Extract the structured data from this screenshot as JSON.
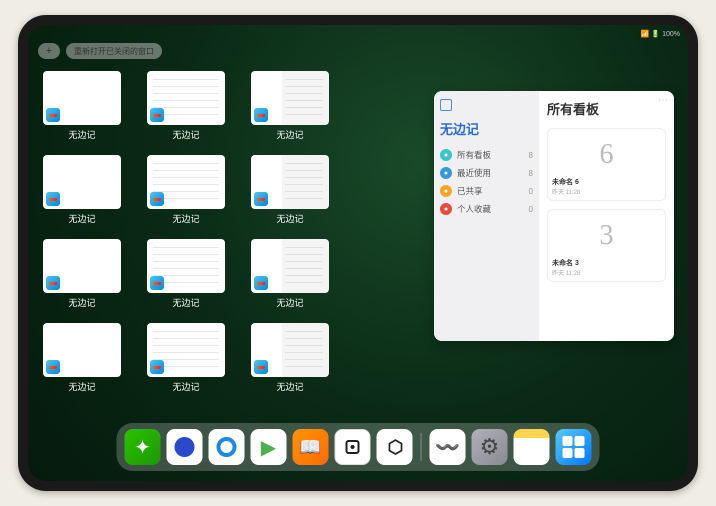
{
  "statusbar": {
    "wifi_text": "100%"
  },
  "topbar": {
    "plus_label": "+",
    "reopen_label": "重新打开已关闭的窗口"
  },
  "windows": [
    {
      "label": "无边记",
      "style": "blank"
    },
    {
      "label": "无边记",
      "style": "lines"
    },
    {
      "label": "无边记",
      "style": "split"
    },
    {
      "label": "无边记",
      "style": "blank"
    },
    {
      "label": "无边记",
      "style": "lines"
    },
    {
      "label": "无边记",
      "style": "split"
    },
    {
      "label": "无边记",
      "style": "blank"
    },
    {
      "label": "无边记",
      "style": "lines"
    },
    {
      "label": "无边记",
      "style": "split"
    },
    {
      "label": "无边记",
      "style": "blank"
    },
    {
      "label": "无边记",
      "style": "lines"
    },
    {
      "label": "无边记",
      "style": "split"
    }
  ],
  "panel": {
    "left_title": "无边记",
    "right_title": "所有看板",
    "rows": [
      {
        "icon_color": "#38c6c8",
        "label": "所有看板",
        "count": "8"
      },
      {
        "icon_color": "#3498db",
        "label": "最近使用",
        "count": "8"
      },
      {
        "icon_color": "#f5a623",
        "label": "已共享",
        "count": "0"
      },
      {
        "icon_color": "#e74c3c",
        "label": "个人收藏",
        "count": "0"
      }
    ],
    "boards": [
      {
        "doodle": "6",
        "label": "未命名 6",
        "sub": "昨天 11:28"
      },
      {
        "doodle": "3",
        "label": "未命名 3",
        "sub": "昨天 11:28"
      }
    ]
  },
  "dock": {
    "apps": [
      {
        "name": "wechat"
      },
      {
        "name": "quark"
      },
      {
        "name": "qqbrowser"
      },
      {
        "name": "play"
      },
      {
        "name": "books"
      },
      {
        "name": "dice"
      },
      {
        "name": "dots"
      },
      {
        "name": "freeform"
      },
      {
        "name": "settings"
      },
      {
        "name": "notes"
      },
      {
        "name": "library"
      }
    ]
  }
}
